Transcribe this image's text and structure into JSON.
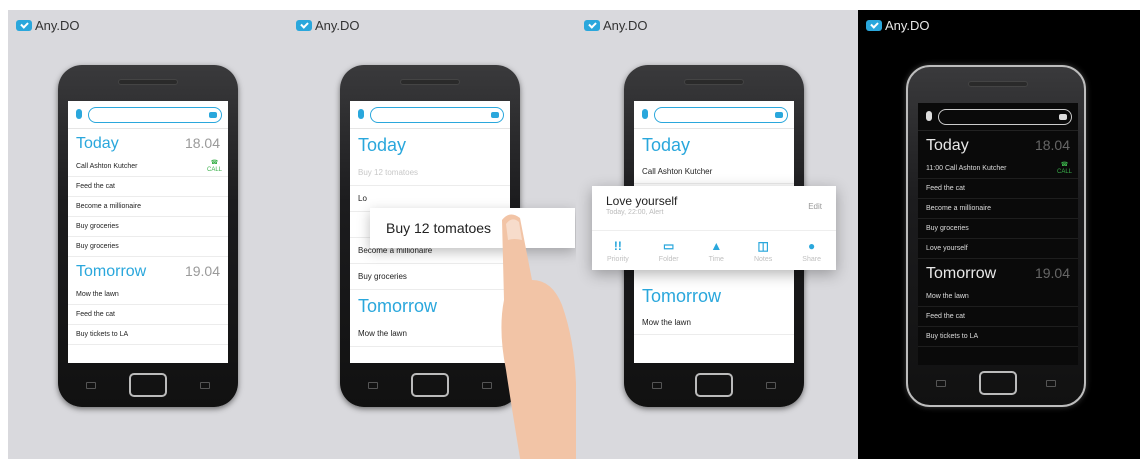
{
  "brand": {
    "name": "Any.DO",
    "accent": "#2aa7dc"
  },
  "panel1": {
    "today": {
      "title": "Today",
      "date": "18.04"
    },
    "today_items": [
      "Call Ashton Kutcher",
      "Feed the cat",
      "Become a millionaire",
      "Buy groceries",
      "Buy groceries"
    ],
    "call_label": "CALL",
    "tomorrow": {
      "title": "Tomorrow",
      "date": "19.04"
    },
    "tomorrow_items": [
      "Mow the lawn",
      "Feed the cat",
      "Buy tickets to LA"
    ]
  },
  "panel2": {
    "today": {
      "title": "Today"
    },
    "faded_item": "Buy 12 tomatoes",
    "partial_item": "Lo",
    "drag_card": "Buy 12 tomatoes",
    "items": [
      "Become a millionaire",
      "Buy groceries"
    ],
    "tomorrow": {
      "title": "Tomorrow"
    },
    "tomorrow_items": [
      "Mow the lawn"
    ]
  },
  "panel3": {
    "today": {
      "title": "Today"
    },
    "items": [
      "Call Ashton Kutcher"
    ],
    "card": {
      "title": "Love yourself",
      "subtitle": "Today, 22:00, Alert",
      "edit": "Edit",
      "options": [
        {
          "label": "Priority",
          "icon": "priority-icon",
          "glyph": "!!"
        },
        {
          "label": "Folder",
          "icon": "folder-icon",
          "glyph": "▭"
        },
        {
          "label": "Time",
          "icon": "bell-icon",
          "glyph": "▲"
        },
        {
          "label": "Notes",
          "icon": "note-icon",
          "glyph": "◫"
        },
        {
          "label": "Share",
          "icon": "person-icon",
          "glyph": "●"
        }
      ]
    },
    "tomorrow": {
      "title": "Tomorrow"
    },
    "tomorrow_items": [
      "Mow the lawn"
    ]
  },
  "panel4": {
    "today": {
      "title": "Today",
      "date": "18.04"
    },
    "first_item": {
      "time": "11:00",
      "text": "Call Ashton Kutcher"
    },
    "call_label": "CALL",
    "today_items": [
      "Feed the cat",
      "Become a millionaire",
      "Buy groceries",
      "Love yourself"
    ],
    "tomorrow": {
      "title": "Tomorrow",
      "date": "19.04"
    },
    "tomorrow_items": [
      "Mow the lawn",
      "Feed the cat",
      "Buy tickets to LA"
    ]
  }
}
